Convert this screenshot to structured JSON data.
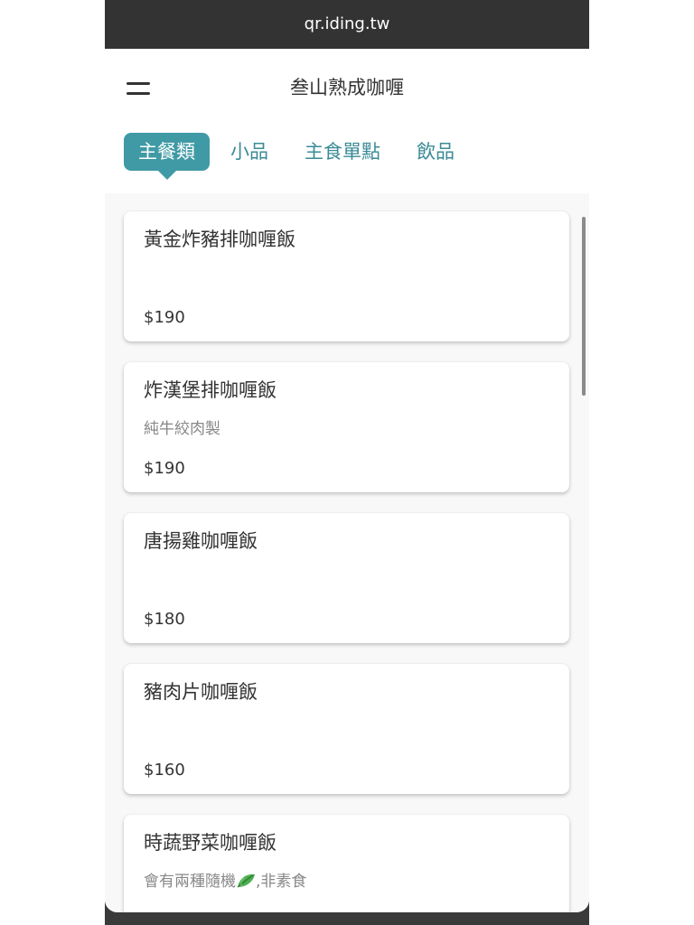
{
  "browser": {
    "url": "qr.iding.tw"
  },
  "header": {
    "title": "叁山熟成咖喱"
  },
  "tabs": [
    {
      "label": "主餐類",
      "active": true
    },
    {
      "label": "小品",
      "active": false
    },
    {
      "label": "主食單點",
      "active": false
    },
    {
      "label": "飲品",
      "active": false
    }
  ],
  "colors": {
    "accent": "#3f9aa5",
    "tab_text": "#3a8b96"
  },
  "menu_items": [
    {
      "name": "黃金炸豬排咖喱飯",
      "description": "",
      "price": "$190"
    },
    {
      "name": "炸漢堡排咖喱飯",
      "description": "純牛絞肉製",
      "price": "$190"
    },
    {
      "name": "唐揚雞咖喱飯",
      "description": "",
      "price": "$180"
    },
    {
      "name": "豬肉片咖喱飯",
      "description": "",
      "price": "$160"
    },
    {
      "name": "時蔬野菜咖喱飯",
      "description_before": "會有兩種隨機",
      "description_icon": "leafy-greens-icon",
      "description_after": ",非素食",
      "price": ""
    }
  ]
}
